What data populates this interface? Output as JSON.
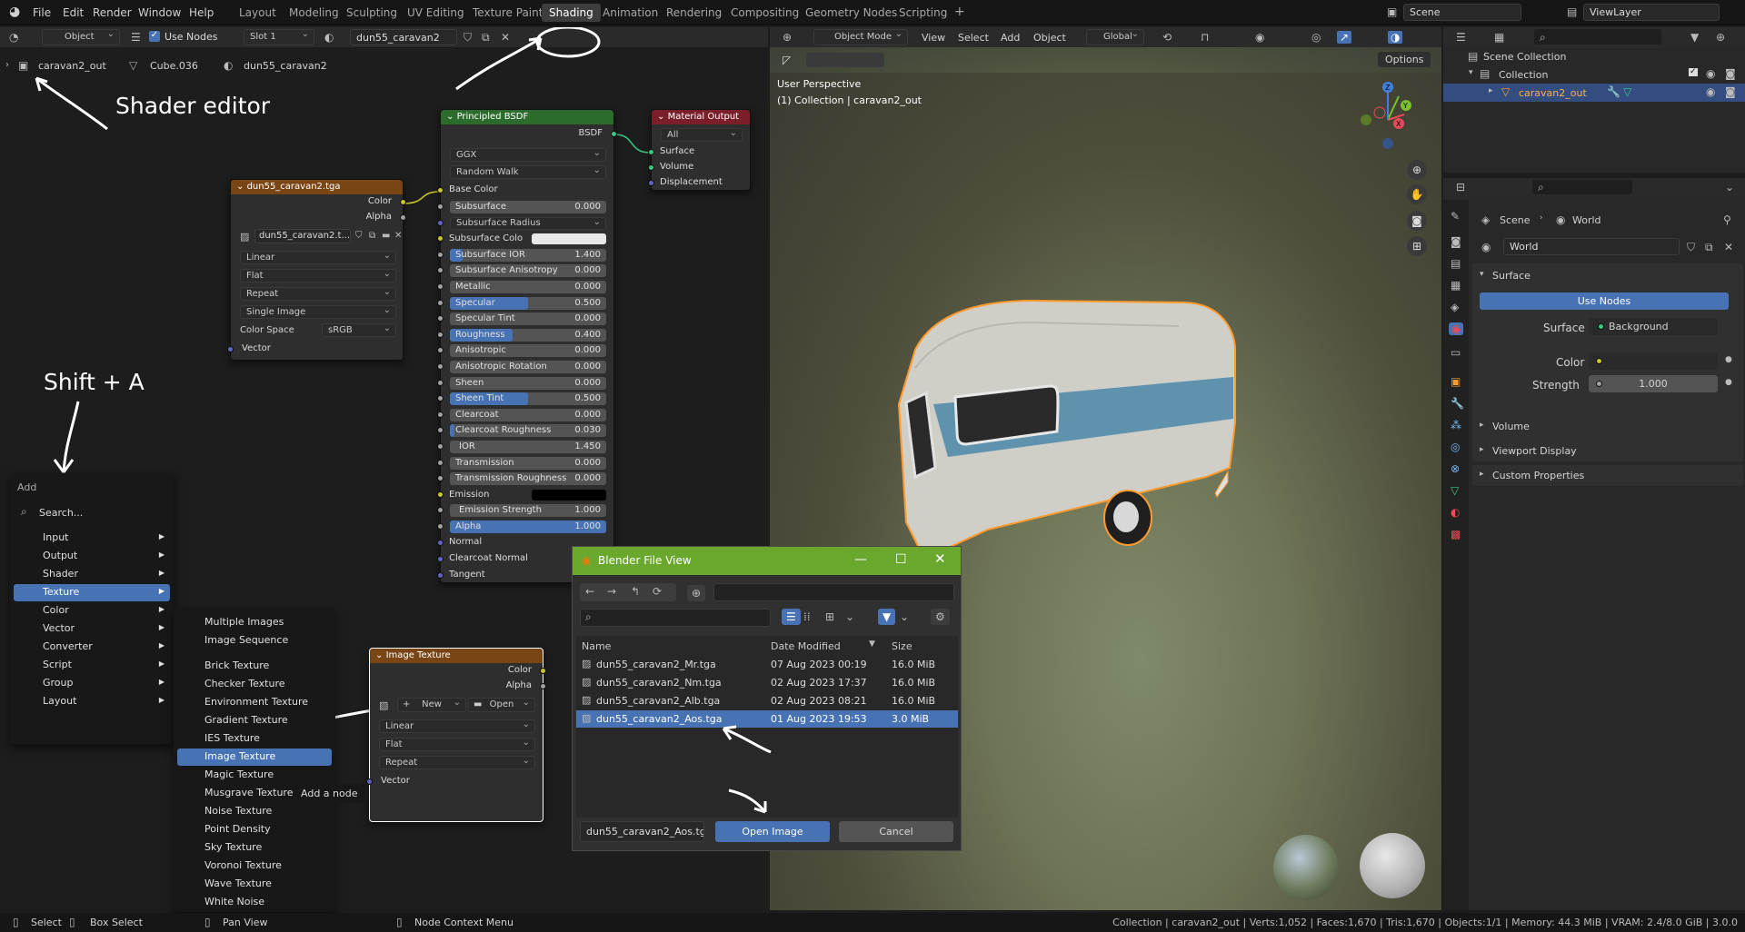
{
  "menubar": {
    "items": [
      "File",
      "Edit",
      "Render",
      "Window",
      "Help"
    ],
    "workspaces": [
      "Layout",
      "Modeling",
      "Sculpting",
      "UV Editing",
      "Texture Paint",
      "Shading",
      "Animation",
      "Rendering",
      "Compositing",
      "Geometry Nodes",
      "Scripting"
    ],
    "add_tab": "+",
    "scene": "Scene",
    "view_layer": "ViewLayer"
  },
  "shader_header": {
    "object_mode": "Object",
    "use_nodes": "Use Nodes",
    "slot": "Slot 1",
    "material": "dun55_caravan2"
  },
  "breadcrumb": [
    "caravan2_out",
    "Cube.036",
    "dun55_caravan2"
  ],
  "annotations": {
    "shader_editor": "Shader editor",
    "shift_a": "Shift + A"
  },
  "image_node": {
    "title": "dun55_caravan2.tga",
    "out_color": "Color",
    "out_alpha": "Alpha",
    "image": "dun55_caravan2.t...",
    "interp": "Linear",
    "proj": "Flat",
    "ext": "Repeat",
    "source": "Single Image",
    "colorspace_label": "Color Space",
    "colorspace": "sRGB",
    "vector": "Vector"
  },
  "bsdf": {
    "title": "Principled BSDF",
    "out": "BSDF",
    "dist": "GGX",
    "sss": "Random Walk",
    "base_color": "Base Color",
    "rows": [
      {
        "label": "Subsurface",
        "value": "0.000",
        "fill": 0
      },
      {
        "label": "Subsurface Radius",
        "select": true
      },
      {
        "label": "Subsurface Colo",
        "color": "#e8e8e8"
      },
      {
        "label": "Subsurface IOR",
        "value": "1.400",
        "fill": 0.08
      },
      {
        "label": "Subsurface Anisotropy",
        "value": "0.000",
        "fill": 0
      },
      {
        "label": "Metallic",
        "value": "0.000",
        "fill": 0
      },
      {
        "label": "Specular",
        "value": "0.500",
        "fill": 0.5
      },
      {
        "label": "Specular Tint",
        "value": "0.000",
        "fill": 0
      },
      {
        "label": "Roughness",
        "value": "0.400",
        "fill": 0.4
      },
      {
        "label": "Anisotropic",
        "value": "0.000",
        "fill": 0
      },
      {
        "label": "Anisotropic Rotation",
        "value": "0.000",
        "fill": 0
      },
      {
        "label": "Sheen",
        "value": "0.000",
        "fill": 0
      },
      {
        "label": "Sheen Tint",
        "value": "0.500",
        "fill": 0.5
      },
      {
        "label": "Clearcoat",
        "value": "0.000",
        "fill": 0
      },
      {
        "label": "Clearcoat Roughness",
        "value": "0.030",
        "fill": 0.03
      },
      {
        "label": "IOR",
        "value": "1.450",
        "fill": 0
      },
      {
        "label": "Transmission",
        "value": "0.000",
        "fill": 0
      },
      {
        "label": "Transmission Roughness",
        "value": "0.000",
        "fill": 0
      },
      {
        "label": "Emission",
        "color": "#000000"
      },
      {
        "label": "Emission Strength",
        "value": "1.000",
        "fill": 0
      },
      {
        "label": "Alpha",
        "value": "1.000",
        "fill": 1
      }
    ],
    "normal": "Normal",
    "cc_normal": "Clearcoat Normal",
    "tangent": "Tangent"
  },
  "mat_out": {
    "title": "Material Output",
    "target": "All",
    "surface": "Surface",
    "volume": "Volume",
    "displacement": "Displacement"
  },
  "add_menu": {
    "title": "Add",
    "search": "Search...",
    "items": [
      "Input",
      "Output",
      "Shader",
      "Texture",
      "Color",
      "Vector",
      "Converter",
      "Script",
      "Group",
      "Layout"
    ],
    "active": "Texture"
  },
  "texture_menu": {
    "items": [
      "Multiple Images",
      "Image Sequence",
      "Brick Texture",
      "Checker Texture",
      "Environment Texture",
      "Gradient Texture",
      "IES Texture",
      "Image Texture",
      "Magic Texture",
      "Musgrave Texture",
      "Noise Texture",
      "Point Density",
      "Sky Texture",
      "Voronoi Texture",
      "Wave Texture",
      "White Noise"
    ],
    "active": "Image Texture",
    "tooltip": "Add a node"
  },
  "new_node": {
    "title": "Image Texture",
    "out_color": "Color",
    "out_alpha": "Alpha",
    "new": "New",
    "open": "Open",
    "interp": "Linear",
    "proj": "Flat",
    "ext": "Repeat",
    "vector": "Vector"
  },
  "viewport": {
    "mode": "Object Mode",
    "menus": [
      "View",
      "Select",
      "Add",
      "Object"
    ],
    "orientation": "Global",
    "options": "Options",
    "title": "User Perspective",
    "subtitle": "(1) Collection | caravan2_out"
  },
  "file_dialog": {
    "title": "Blender File View",
    "col_name": "Name",
    "col_date": "Date Modified",
    "col_size": "Size",
    "files": [
      {
        "name": "dun55_caravan2_Mr.tga",
        "date": "07 Aug 2023 00:19",
        "size": "16.0 MiB"
      },
      {
        "name": "dun55_caravan2_Nm.tga",
        "date": "02 Aug 2023 17:37",
        "size": "16.0 MiB"
      },
      {
        "name": "dun55_caravan2_Alb.tga",
        "date": "02 Aug 2023 08:21",
        "size": "16.0 MiB"
      },
      {
        "name": "dun55_caravan2_Aos.tga",
        "date": "01 Aug 2023 19:53",
        "size": "3.0 MiB"
      }
    ],
    "selected_index": 3,
    "filename": "dun55_caravan2_Aos.tga",
    "open_btn": "Open Image",
    "cancel_btn": "Cancel"
  },
  "outliner": {
    "scene_collection": "Scene Collection",
    "collection": "Collection",
    "object": "caravan2_out"
  },
  "properties": {
    "scene": "Scene",
    "world_crumb": "World",
    "world": "World",
    "surface_panel": "Surface",
    "use_nodes": "Use Nodes",
    "surface_label": "Surface",
    "surface_value": "Background",
    "color_label": "Color",
    "strength_label": "Strength",
    "strength_value": "1.000",
    "panels": [
      "Volume",
      "Viewport Display",
      "Custom Properties"
    ]
  },
  "statusbar": {
    "select": "Select",
    "box_select": "Box Select",
    "pan": "Pan View",
    "context": "Node Context Menu",
    "stats": "Collection | caravan2_out | Verts:1,052 | Faces:1,670 | Tris:1,670 | Objects:1/1 | Memory: 44.3 MiB | VRAM: 2.4/8.0 GiB | 3.0.0"
  },
  "colors": {
    "accent": "#4772b3",
    "texture_header": "#7a4514",
    "shader_header": "#2b6b2b",
    "output_header": "#7a1e2a",
    "selection": "#ff9a2e"
  }
}
